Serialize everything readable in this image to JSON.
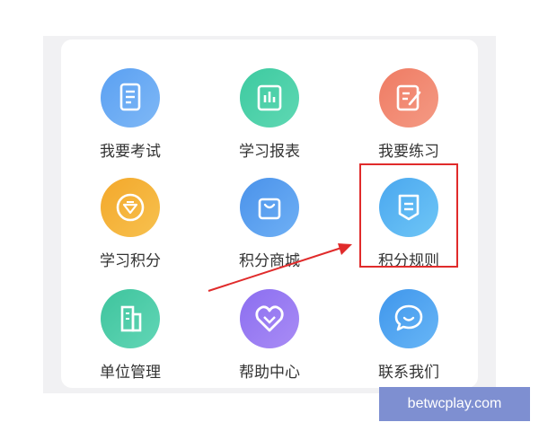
{
  "grid": {
    "items": [
      {
        "label": "我要考试",
        "icon": "exam-doc-icon",
        "color_from": "#5aa0f2",
        "color_to": "#7fb8f6"
      },
      {
        "label": "学习报表",
        "icon": "report-chart-icon",
        "color_from": "#3dcaa0",
        "color_to": "#5fd8b3"
      },
      {
        "label": "我要练习",
        "icon": "practice-edit-icon",
        "color_from": "#ef7b63",
        "color_to": "#f49a84"
      },
      {
        "label": "学习积分",
        "icon": "points-gem-icon",
        "color_from": "#f3a82b",
        "color_to": "#f7c14f"
      },
      {
        "label": "积分商城",
        "icon": "shopping-bag-icon",
        "color_from": "#4a92ea",
        "color_to": "#6fb0f5"
      },
      {
        "label": "积分规则",
        "icon": "rules-doc-icon",
        "color_from": "#4aa7ef",
        "color_to": "#6fc6f6"
      },
      {
        "label": "单位管理",
        "icon": "building-icon",
        "color_from": "#3ec49d",
        "color_to": "#62d6b6"
      },
      {
        "label": "帮助中心",
        "icon": "help-heart-icon",
        "color_from": "#8b6ef0",
        "color_to": "#a98cf5"
      },
      {
        "label": "联系我们",
        "icon": "chat-bubble-icon",
        "color_from": "#3f96ec",
        "color_to": "#68b6f6"
      }
    ]
  },
  "highlight": {
    "target": "积分规则",
    "color": "#e02b2b"
  },
  "watermark": {
    "text": "betwcplay.com"
  }
}
